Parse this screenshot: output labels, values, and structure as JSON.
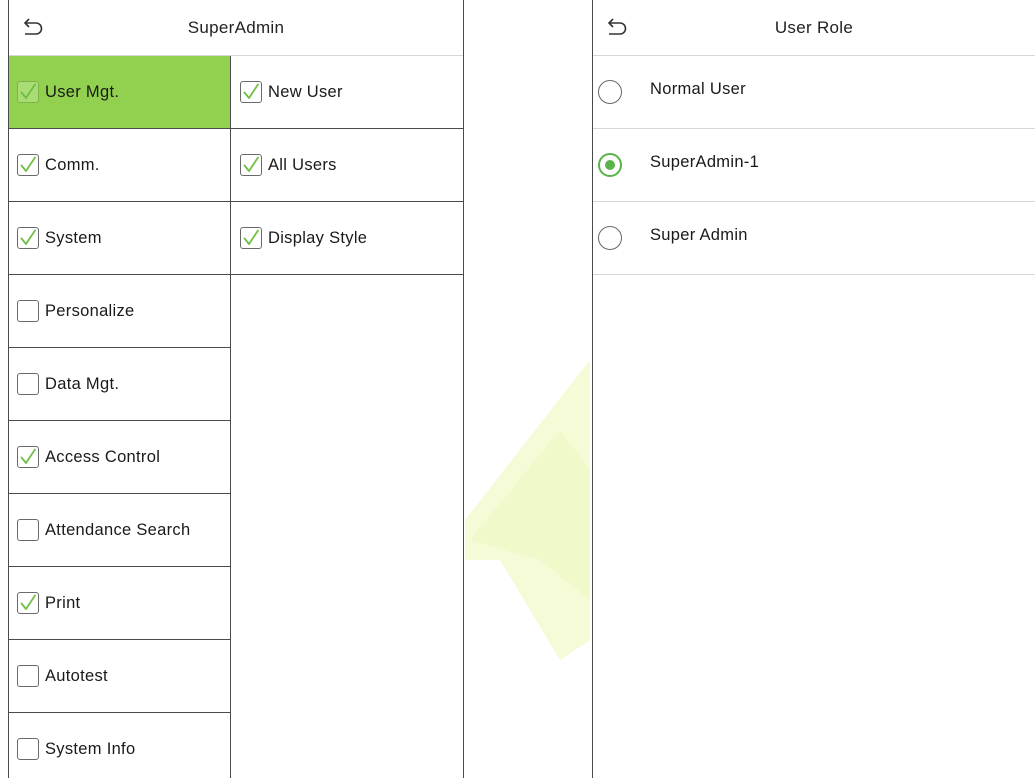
{
  "left_screen": {
    "title": "SuperAdmin",
    "categories": [
      {
        "label": "User Mgt.",
        "checked": true,
        "selected": true
      },
      {
        "label": "Comm.",
        "checked": true,
        "selected": false
      },
      {
        "label": "System",
        "checked": true,
        "selected": false
      },
      {
        "label": "Personalize",
        "checked": false,
        "selected": false
      },
      {
        "label": "Data Mgt.",
        "checked": false,
        "selected": false
      },
      {
        "label": "Access Control",
        "checked": true,
        "selected": false
      },
      {
        "label": "Attendance Search",
        "checked": false,
        "selected": false
      },
      {
        "label": "Print",
        "checked": true,
        "selected": false
      },
      {
        "label": "Autotest",
        "checked": false,
        "selected": false
      },
      {
        "label": "System Info",
        "checked": false,
        "selected": false
      }
    ],
    "sub_items": [
      {
        "label": "New User",
        "checked": true
      },
      {
        "label": "All Users",
        "checked": true
      },
      {
        "label": "Display Style",
        "checked": true
      }
    ]
  },
  "right_screen": {
    "title": "User Role",
    "roles": [
      {
        "label": "Normal User",
        "selected": false
      },
      {
        "label": "SuperAdmin-1",
        "selected": true
      },
      {
        "label": "Super Admin",
        "selected": false
      }
    ]
  },
  "colors": {
    "selected_row": "#92d14f",
    "check_mark": "#6fbf44",
    "radio_selected": "#59b34a",
    "watermark": "#f3fbd2"
  },
  "icons": {
    "back": "back-arrow-icon",
    "check": "checkmark-icon"
  }
}
